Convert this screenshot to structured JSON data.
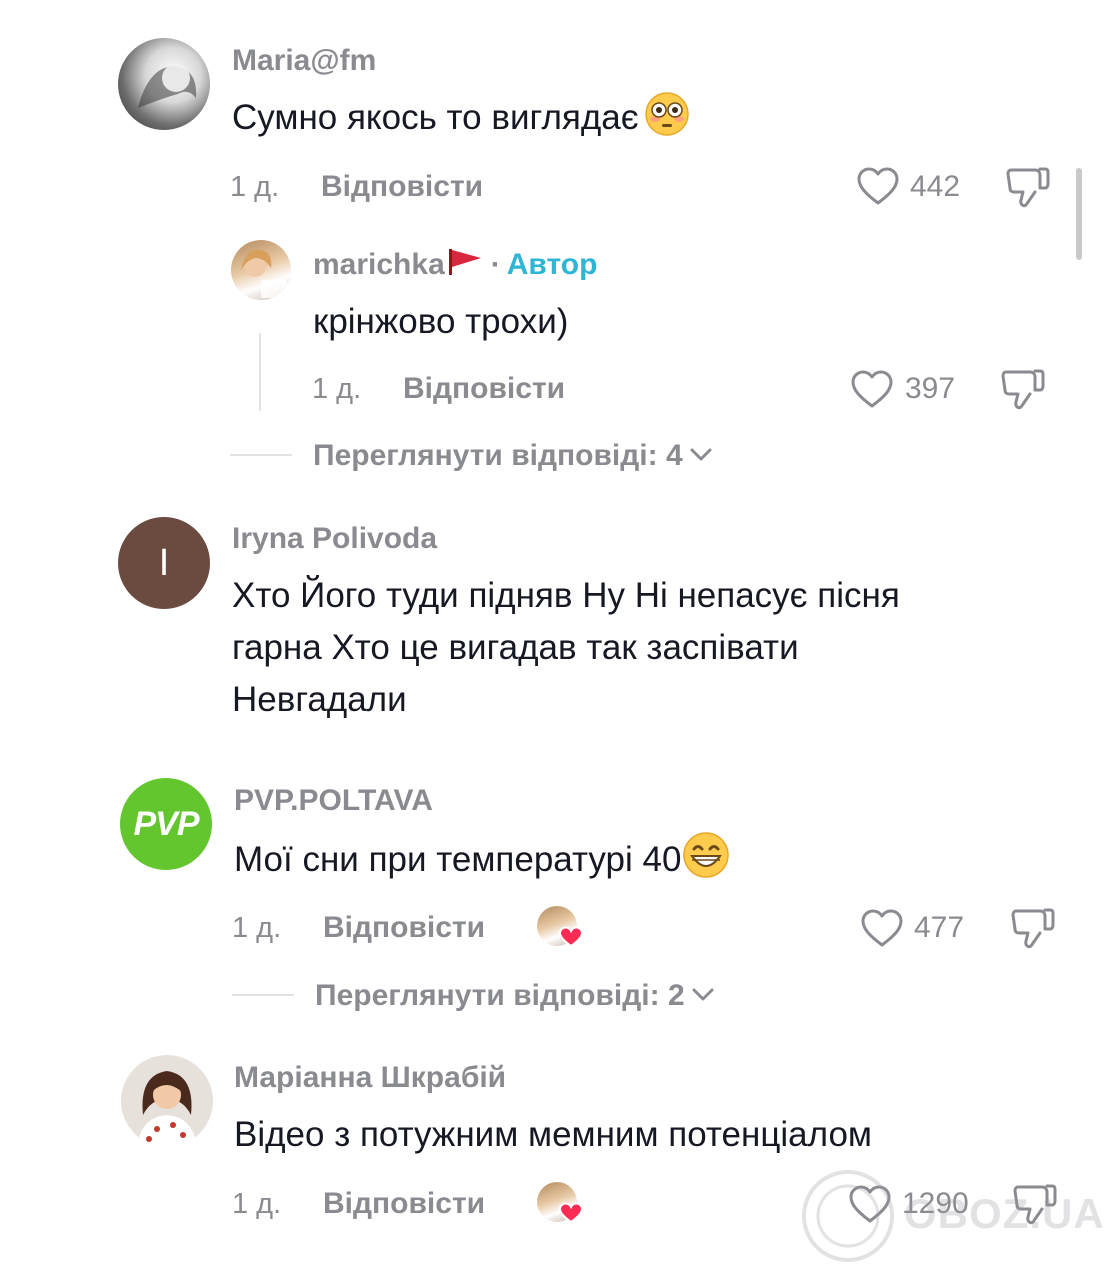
{
  "comments": [
    {
      "username": "Maria@fm",
      "text": "Сумно якось то виглядає",
      "time": "1 д.",
      "reply_label": "Відповісти",
      "likes": "442",
      "replies": [
        {
          "username": "marichka",
          "author_label": "Автор",
          "text": "крінжово трохи)",
          "time": "1 д.",
          "reply_label": "Відповісти",
          "likes": "397"
        }
      ],
      "view_replies": "Переглянути відповіді: 4"
    },
    {
      "username": "Iryna Polivoda",
      "avatar_letter": "I",
      "avatar_color": "#6b4a3f",
      "text_lines": [
        "Хто Його туди підняв Ну Ні непасує пісня",
        "гарна Хто це вигадав так заспівати",
        "Невгадали"
      ]
    },
    {
      "username": "PVP.POLTAVA",
      "avatar_text": "PVP",
      "avatar_color": "#63c62f",
      "text": "Мої сни при температурі 40",
      "time": "1 д.",
      "reply_label": "Відповісти",
      "likes": "477",
      "view_replies": "Переглянути відповіді: 2"
    },
    {
      "username": "Маріанна Шкрабій",
      "text": "Відео з потужним мемним потенціалом",
      "time": "1 д.",
      "reply_label": "Відповісти",
      "likes": "1290"
    }
  ],
  "watermark": "OBOZ.UA",
  "colors": {
    "muted": "#8a8b91",
    "author_accent": "#2fb5d6",
    "liked_heart": "#fe2c55"
  }
}
